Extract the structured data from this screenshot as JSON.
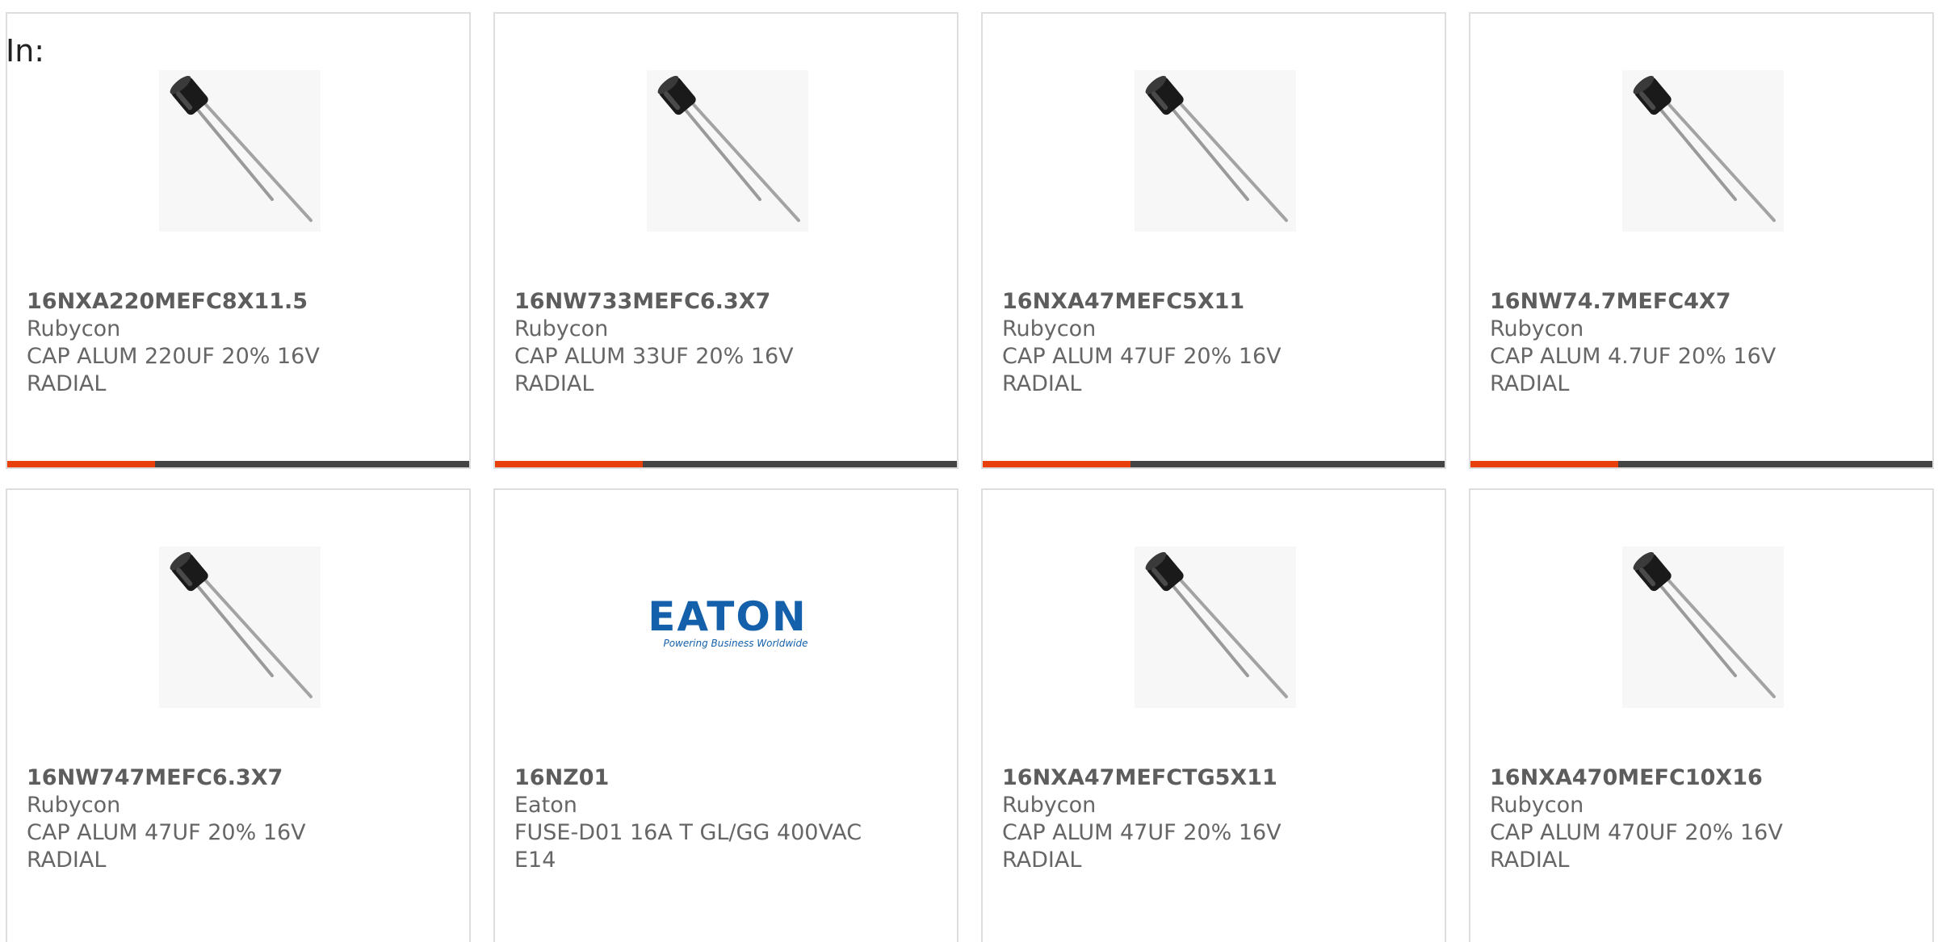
{
  "header": {
    "label": "In:"
  },
  "colors": {
    "accent": "#e8400c",
    "bar_track": "#444444",
    "eaton_blue": "#1460aa"
  },
  "products": [
    {
      "part_number": "16NXA220MEFC8X11.5",
      "manufacturer": "Rubycon",
      "description": "CAP ALUM 220UF 20% 16V\nRADIAL",
      "image": "capacitor-image",
      "progress": 0.32
    },
    {
      "part_number": "16NW733MEFC6.3X7",
      "manufacturer": "Rubycon",
      "description": "CAP ALUM 33UF 20% 16V\nRADIAL",
      "image": "capacitor-image",
      "progress": 0.32
    },
    {
      "part_number": "16NXA47MEFC5X11",
      "manufacturer": "Rubycon",
      "description": "CAP ALUM 47UF 20% 16V\nRADIAL",
      "image": "capacitor-image",
      "progress": 0.32
    },
    {
      "part_number": "16NW74.7MEFC4X7",
      "manufacturer": "Rubycon",
      "description": "CAP ALUM 4.7UF 20% 16V\nRADIAL",
      "image": "capacitor-image",
      "progress": 0.32
    },
    {
      "part_number": "16NW747MEFC6.3X7",
      "manufacturer": "Rubycon",
      "description": "CAP ALUM 47UF 20% 16V\nRADIAL",
      "image": "capacitor-image"
    },
    {
      "part_number": "16NZ01",
      "manufacturer": "Eaton",
      "description": "FUSE-D01 16A T GL/GG 400VAC\nE14",
      "image": "eaton-logo",
      "logo_text": "EATON",
      "logo_tagline": "Powering Business Worldwide"
    },
    {
      "part_number": "16NXA47MEFCTG5X11",
      "manufacturer": "Rubycon",
      "description": "CAP ALUM 47UF 20% 16V\nRADIAL",
      "image": "capacitor-image"
    },
    {
      "part_number": "16NXA470MEFC10X16",
      "manufacturer": "Rubycon",
      "description": "CAP ALUM 470UF 20% 16V\nRADIAL",
      "image": "capacitor-image"
    }
  ]
}
